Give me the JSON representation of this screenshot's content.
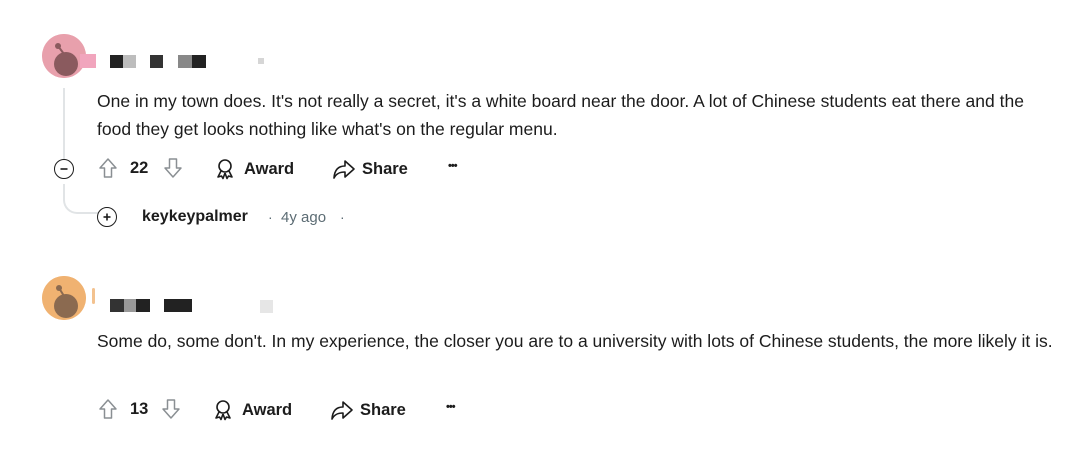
{
  "comments": [
    {
      "avatar_color": "#e8a0ac",
      "body": "One in my town does. It's not really a secret, it's a white board near the door. A lot of Chinese students eat there and the food they get looks nothing like what's on the regular menu.",
      "vote_count": "22",
      "award_label": "Award",
      "share_label": "Share",
      "more_label": "•••",
      "collapse_icon": "minus-circle-icon",
      "reply": {
        "username": "keykeypalmer",
        "separator": "·",
        "time": "4y ago",
        "trailing_separator": "·",
        "expand_icon": "plus-circle-icon"
      }
    },
    {
      "avatar_color": "#f0b271",
      "body": "Some do, some don't. In my experience, the closer you are to a university with lots of Chinese students, the more likely it is.",
      "vote_count": "13",
      "award_label": "Award",
      "share_label": "Share",
      "more_label": "•••"
    }
  ]
}
